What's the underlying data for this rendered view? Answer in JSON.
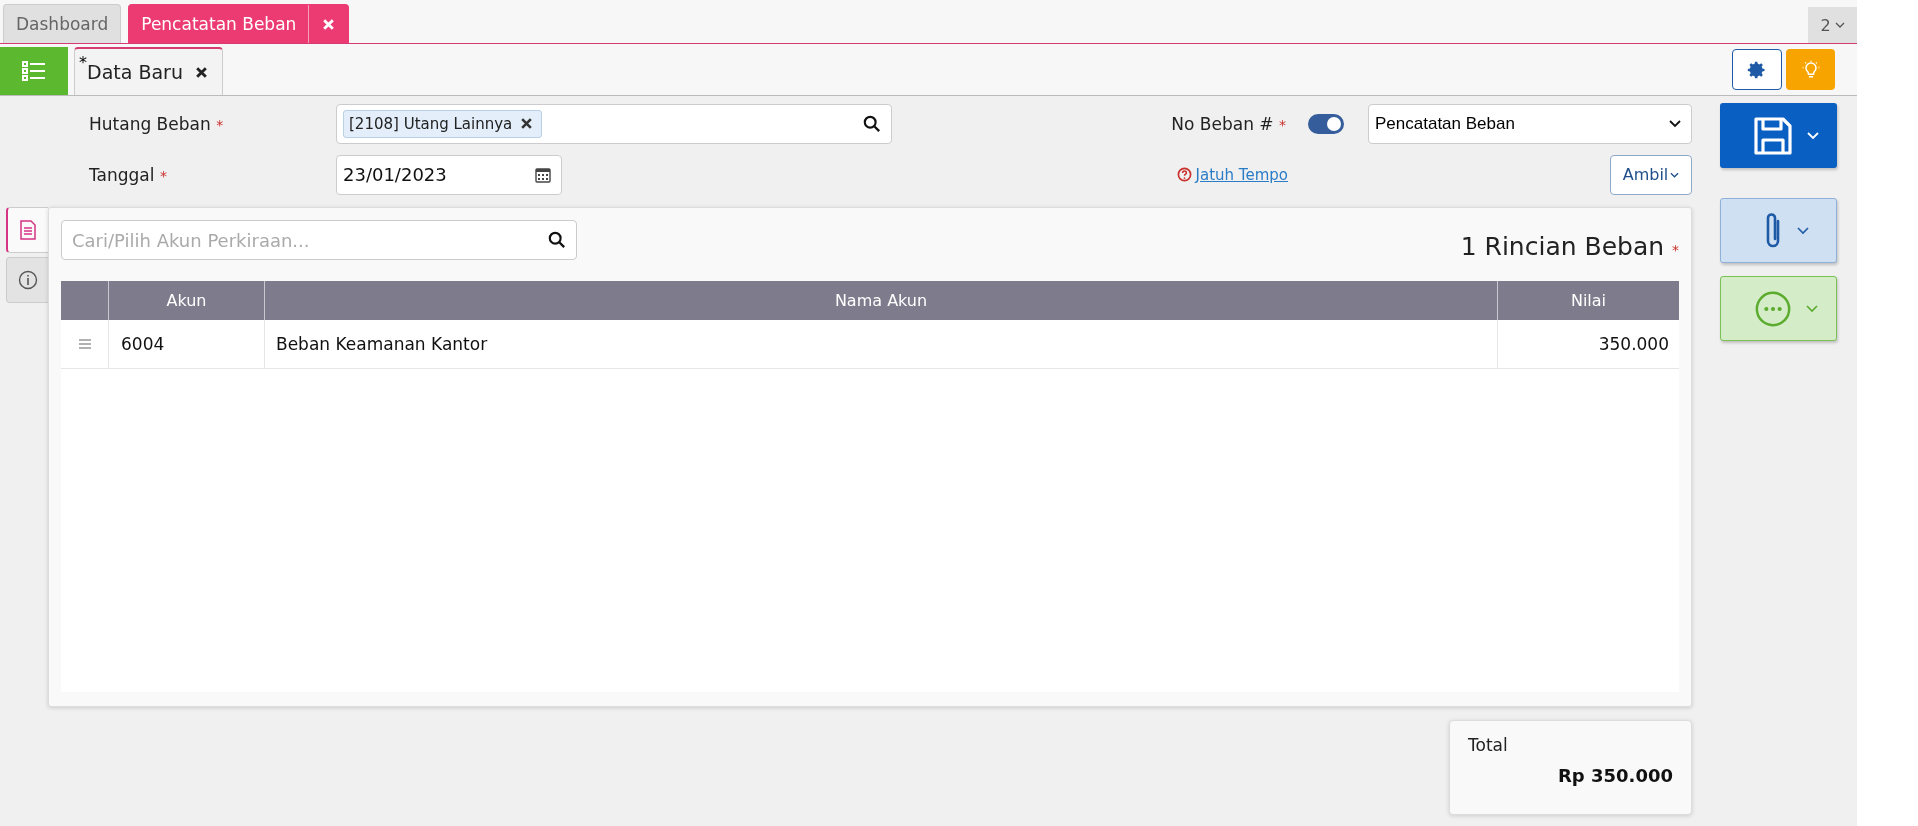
{
  "top_tabs": [
    {
      "label": "Dashboard",
      "selected": false,
      "closable": false
    },
    {
      "label": "Pencatatan Beban",
      "selected": true,
      "closable": true
    }
  ],
  "tab_count": "2",
  "doc_tab": {
    "label": "Data Baru",
    "modified_mark": "*"
  },
  "form": {
    "hutang_label": "Hutang Beban",
    "hutang_tag": "[2108] Utang Lainnya",
    "tanggal_label": "Tanggal",
    "tanggal_value": "23/01/2023",
    "required_mark": "*",
    "no_label": "No Beban #",
    "auto_number": true,
    "no_select": "Pencatatan Beban",
    "due_link": "Jatuh Tempo",
    "ambil_button": "Ambil"
  },
  "side_tabs": [
    {
      "kind": "document",
      "selected": true
    },
    {
      "kind": "info",
      "selected": false
    }
  ],
  "details": {
    "search_placeholder": "Cari/Pilih Akun Perkiraan...",
    "title": "1 Rincian Beban",
    "columns": [
      "Akun",
      "Nama Akun",
      "Nilai"
    ],
    "rows": [
      {
        "akun": "6004",
        "nama": "Beban Keamanan Kantor",
        "nilai": "350.000"
      }
    ]
  },
  "total": {
    "label": "Total",
    "value": "Rp 350.000"
  }
}
